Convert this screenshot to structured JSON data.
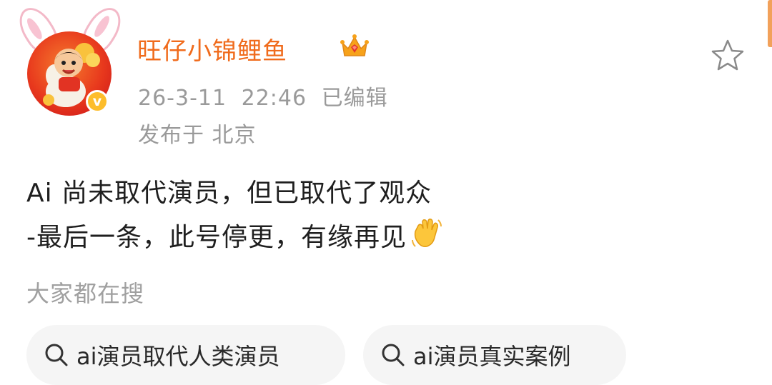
{
  "post": {
    "author": {
      "name": "旺仔小锦鲤鱼",
      "verified_mark": "v"
    },
    "timestamp": "26-3-11 22:46",
    "edited_label": "已编辑",
    "location": "发布于 北京",
    "content_lines": [
      "Ai 尚未取代演员，但已取代了观众",
      "-最后一条，此号停更，有缘再见"
    ],
    "emoji": "waving-hand"
  },
  "search": {
    "title": "大家都在搜",
    "chips": [
      {
        "label": "ai演员取代人类演员"
      },
      {
        "label": "ai演员真实案例"
      }
    ]
  },
  "colors": {
    "username": "#f06b1c",
    "meta_text": "#9a9a9a",
    "chip_bg": "#f5f5f5",
    "verified_badge": "#fdbd2b",
    "accent_bar": "#f2a15a"
  }
}
